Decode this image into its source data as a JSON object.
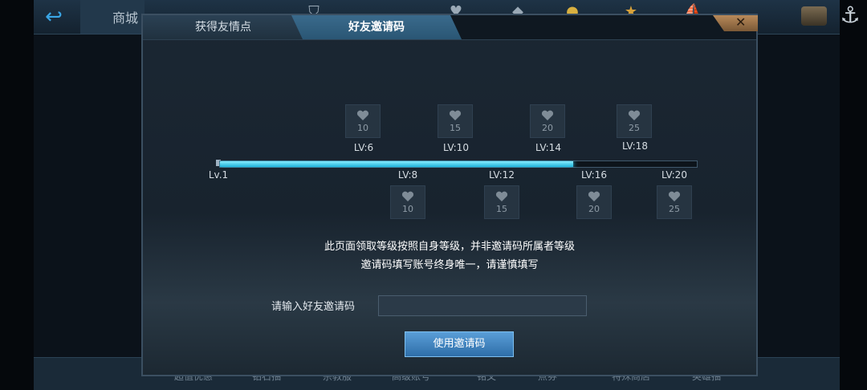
{
  "background": {
    "store_tab_label": "商城",
    "bottom_items": [
      "超值优惠",
      "钻石抽",
      "宗教服",
      "高级账号",
      "铭文",
      "点券",
      "特殊商店",
      "英雄抽"
    ]
  },
  "dialog": {
    "tabs": [
      {
        "label": "获得友情点",
        "active": false
      },
      {
        "label": "好友邀请码",
        "active": true
      }
    ],
    "progress": {
      "start_label": "Lv.1",
      "fill_fraction": 0.74
    },
    "rewards_top": [
      {
        "level": "LV:6",
        "value": "10"
      },
      {
        "level": "LV:10",
        "value": "15"
      },
      {
        "level": "LV:14",
        "value": "20"
      },
      {
        "level": "LV:18",
        "value": "25"
      }
    ],
    "rewards_bottom": [
      {
        "level": "LV:8",
        "value": "10"
      },
      {
        "level": "LV:12",
        "value": "15"
      },
      {
        "level": "LV:16",
        "value": "20"
      },
      {
        "level": "LV:20",
        "value": "25"
      }
    ],
    "notice_line1": "此页面领取等级按照自身等级，并非邀请码所属者等级",
    "notice_line2": "邀请码填写账号终身唯一，请谨慎填写",
    "input_label": "请输入好友邀请码",
    "input_value": "",
    "submit_label": "使用邀请码"
  },
  "colors": {
    "progress_fill": "#38c8f0",
    "button": "#3f86c4"
  }
}
